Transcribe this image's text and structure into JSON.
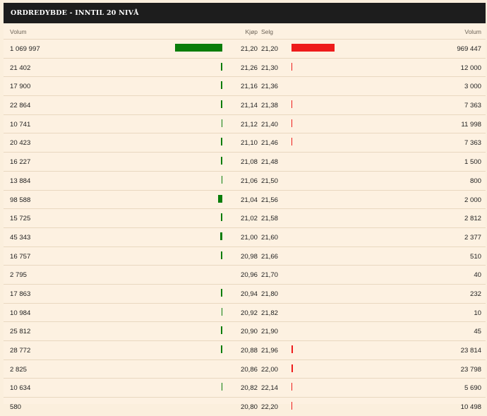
{
  "header": {
    "title": "ORDREDYBDE - INNTIL 20 NIVÅ"
  },
  "columns": {
    "buy_volume": "Volum",
    "buy_price": "Kjøp",
    "sell_price": "Selg",
    "sell_volume": "Volum"
  },
  "colors": {
    "buy": "#0a7d0a",
    "sell": "#ee1b1b",
    "header_bg": "#1d1d1d",
    "bg": "#fdf1e1"
  },
  "max_volume": 1069997,
  "rows": [
    {
      "buy_volume": "1 069 997",
      "buy_price": "21,20",
      "sell_price": "21,20",
      "sell_volume": "969 447",
      "buy_depth": 1069997,
      "sell_depth": 969447
    },
    {
      "buy_volume": "21 402",
      "buy_price": "21,26",
      "sell_price": "21,30",
      "sell_volume": "12 000",
      "buy_depth": 21402,
      "sell_depth": 12000
    },
    {
      "buy_volume": "17 900",
      "buy_price": "21,16",
      "sell_price": "21,36",
      "sell_volume": "3 000",
      "buy_depth": 17900,
      "sell_depth": 3000
    },
    {
      "buy_volume": "22 864",
      "buy_price": "21,14",
      "sell_price": "21,38",
      "sell_volume": "7 363",
      "buy_depth": 22864,
      "sell_depth": 7363
    },
    {
      "buy_volume": "10 741",
      "buy_price": "21,12",
      "sell_price": "21,40",
      "sell_volume": "11 998",
      "buy_depth": 10741,
      "sell_depth": 11998
    },
    {
      "buy_volume": "20 423",
      "buy_price": "21,10",
      "sell_price": "21,46",
      "sell_volume": "7 363",
      "buy_depth": 20423,
      "sell_depth": 7363
    },
    {
      "buy_volume": "16 227",
      "buy_price": "21,08",
      "sell_price": "21,48",
      "sell_volume": "1 500",
      "buy_depth": 16227,
      "sell_depth": 1500
    },
    {
      "buy_volume": "13 884",
      "buy_price": "21,06",
      "sell_price": "21,50",
      "sell_volume": "800",
      "buy_depth": 13884,
      "sell_depth": 800
    },
    {
      "buy_volume": "98 588",
      "buy_price": "21,04",
      "sell_price": "21,56",
      "sell_volume": "2 000",
      "buy_depth": 98588,
      "sell_depth": 2000
    },
    {
      "buy_volume": "15 725",
      "buy_price": "21,02",
      "sell_price": "21,58",
      "sell_volume": "2 812",
      "buy_depth": 15725,
      "sell_depth": 2812
    },
    {
      "buy_volume": "45 343",
      "buy_price": "21,00",
      "sell_price": "21,60",
      "sell_volume": "2 377",
      "buy_depth": 45343,
      "sell_depth": 2377
    },
    {
      "buy_volume": "16 757",
      "buy_price": "20,98",
      "sell_price": "21,66",
      "sell_volume": "510",
      "buy_depth": 16757,
      "sell_depth": 510
    },
    {
      "buy_volume": "2 795",
      "buy_price": "20,96",
      "sell_price": "21,70",
      "sell_volume": "40",
      "buy_depth": 2795,
      "sell_depth": 40
    },
    {
      "buy_volume": "17 863",
      "buy_price": "20,94",
      "sell_price": "21,80",
      "sell_volume": "232",
      "buy_depth": 17863,
      "sell_depth": 232
    },
    {
      "buy_volume": "10 984",
      "buy_price": "20,92",
      "sell_price": "21,82",
      "sell_volume": "10",
      "buy_depth": 10984,
      "sell_depth": 10
    },
    {
      "buy_volume": "25 812",
      "buy_price": "20,90",
      "sell_price": "21,90",
      "sell_volume": "45",
      "buy_depth": 25812,
      "sell_depth": 45
    },
    {
      "buy_volume": "28 772",
      "buy_price": "20,88",
      "sell_price": "21,96",
      "sell_volume": "23 814",
      "buy_depth": 28772,
      "sell_depth": 23814
    },
    {
      "buy_volume": "2 825",
      "buy_price": "20,86",
      "sell_price": "22,00",
      "sell_volume": "23 798",
      "buy_depth": 2825,
      "sell_depth": 23798
    },
    {
      "buy_volume": "10 634",
      "buy_price": "20,82",
      "sell_price": "22,14",
      "sell_volume": "5 690",
      "buy_depth": 10634,
      "sell_depth": 5690
    },
    {
      "buy_volume": "580",
      "buy_price": "20,80",
      "sell_price": "22,20",
      "sell_volume": "10 498",
      "buy_depth": 580,
      "sell_depth": 10498
    }
  ]
}
